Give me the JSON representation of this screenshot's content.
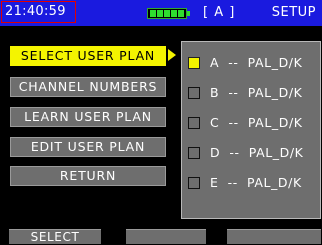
{
  "status_bar": {
    "clock": "21:40:59",
    "mode": "[ A ]",
    "title": "SETUP",
    "battery_level": 1.0,
    "colors": {
      "bar_background": "#1a1adf",
      "clock_border": "#e00000",
      "battery": "#2fdc2f"
    }
  },
  "menu": {
    "items": [
      {
        "label": "SELECT USER PLAN",
        "selected": true
      },
      {
        "label": "CHANNEL NUMBERS",
        "selected": false
      },
      {
        "label": "LEARN USER PLAN",
        "selected": false
      },
      {
        "label": "EDIT USER PLAN",
        "selected": false
      },
      {
        "label": "RETURN",
        "selected": false
      }
    ],
    "highlight_color": "#f4f400"
  },
  "plans": {
    "items": [
      {
        "label": "A  --  PAL_D/K",
        "checked": true
      },
      {
        "label": "B  --  PAL_D/K",
        "checked": false
      },
      {
        "label": "C  --  PAL_D/K",
        "checked": false
      },
      {
        "label": "D  --  PAL_D/K",
        "checked": false
      },
      {
        "label": "E  --  PAL_D/K",
        "checked": false
      }
    ]
  },
  "softkeys": [
    {
      "label": "SELECT"
    },
    {
      "label": ""
    },
    {
      "label": ""
    }
  ]
}
